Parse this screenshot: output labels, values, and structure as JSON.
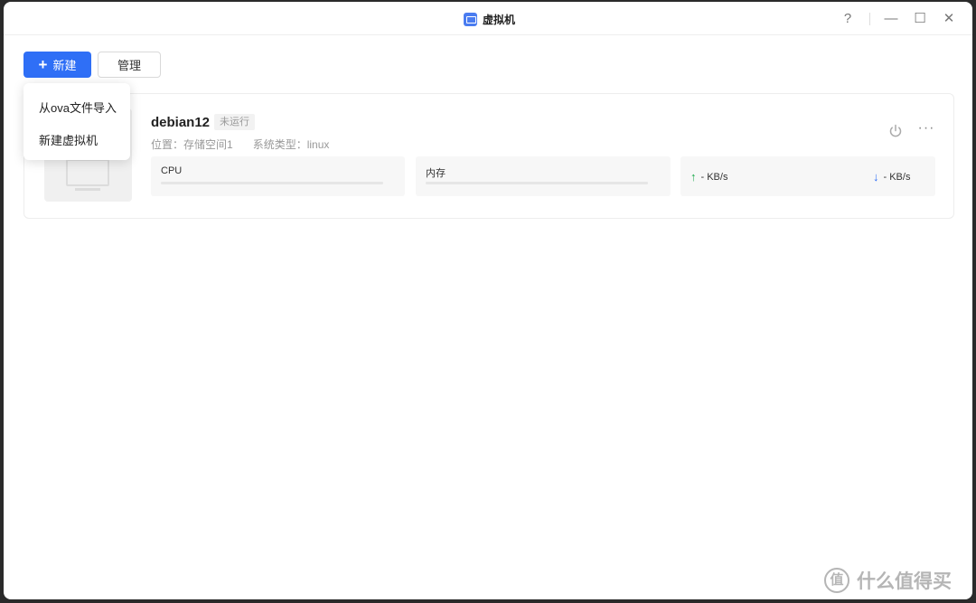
{
  "window": {
    "title": "虚拟机",
    "controls": {
      "help": "?",
      "minimize": "—",
      "maximize": "☐",
      "close": "✕"
    }
  },
  "toolbar": {
    "new_icon": "+",
    "new_label": "新建",
    "manage_label": "管理"
  },
  "dropdown": {
    "items": [
      {
        "label": "从ova文件导入"
      },
      {
        "label": "新建虚拟机"
      }
    ]
  },
  "vm": {
    "name": "debian12",
    "status": "未运行",
    "location": "位置：存储空间1",
    "os_type": "系统类型：linux",
    "cpu_label": "CPU",
    "cpu_usage": 0,
    "mem_label": "内存",
    "mem_usage": 0,
    "upload": "- KB/s",
    "download": "- KB/s",
    "more": "···"
  },
  "watermark": {
    "logo": "值",
    "text": "什么值得买"
  },
  "colors": {
    "accent": "#2f6ff6",
    "upload_arrow": "#19a84a",
    "download_arrow": "#2f6ff6"
  }
}
